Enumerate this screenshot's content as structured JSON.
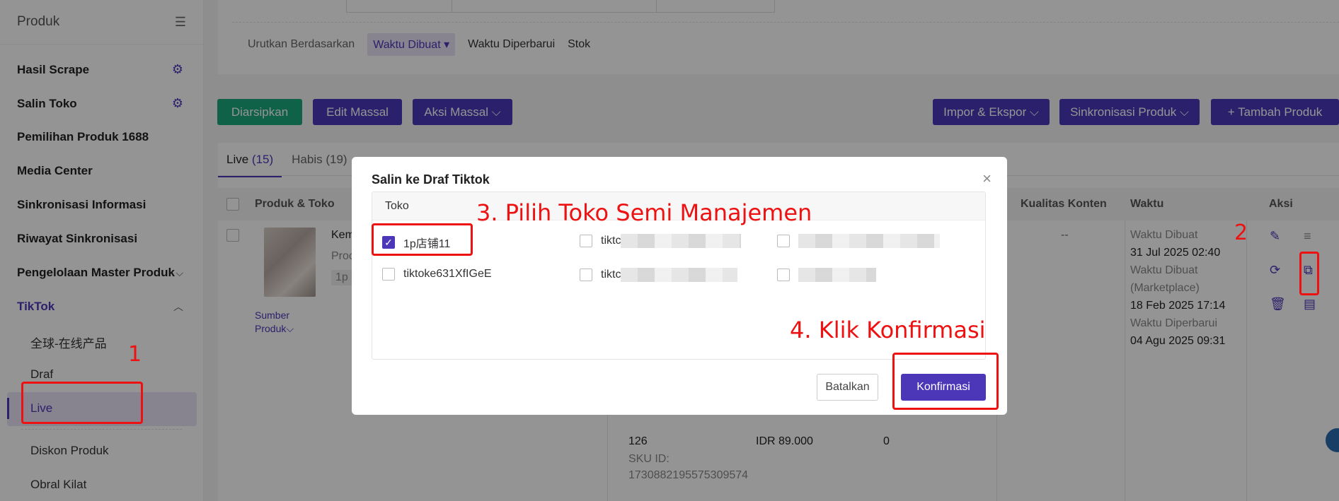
{
  "sidebar": {
    "title": "Produk",
    "items": [
      {
        "label": "Hasil Scrape",
        "icon": "gear-icon"
      },
      {
        "label": "Salin Toko",
        "icon": "gear-icon"
      },
      {
        "label": "Pemilihan Produk 1688"
      },
      {
        "label": "Media Center"
      },
      {
        "label": "Sinkronisasi Informasi"
      },
      {
        "label": "Riwayat Sinkronisasi"
      },
      {
        "label": "Pengelolaan Master Produk"
      },
      {
        "label": "TikTok"
      }
    ],
    "sub_items": [
      "全球-在线产品",
      "Draf",
      "Live",
      "Diskon Produk",
      "Obral Kilat"
    ]
  },
  "sort": {
    "label": "Urutkan Berdasarkan",
    "options": [
      "Waktu Dibuat ▾",
      "Waktu Diperbarui",
      "Stok"
    ]
  },
  "toolbar": {
    "archive": "Diarsipkan",
    "bulk_edit": "Edit Massal",
    "bulk_action": "Aksi Massal ⌵",
    "import_export": "Impor & Ekspor ⌵",
    "sync": "Sinkronisasi Produk ⌵",
    "add": "+ Tambah Produk"
  },
  "tabs": {
    "live": "Live",
    "live_count": "(15)",
    "habis": "Habis (19)"
  },
  "table": {
    "headers": {
      "product": "Produk & Toko",
      "quality": "Kualitas Konten",
      "time": "Waktu",
      "action": "Aksi"
    },
    "row": {
      "name_partial": "Kem",
      "prod_partial": "Proc",
      "tag_partial": "1p",
      "source_label": "Sumber",
      "source_label2": "Produk⌵",
      "quality": "--",
      "created_label": "Waktu Dibuat",
      "created_value": "31 Jul 2025 02:40",
      "mp_created_label": "Waktu Dibuat",
      "mp_created_label2": "(Marketplace)",
      "mp_created_value": "18 Feb 2025 17:14",
      "updated_label": "Waktu Diperbarui",
      "updated_value": "04 Agu 2025 09:31",
      "stock": "126",
      "price": "IDR 89.000",
      "sold": "0",
      "sku_label": "SKU ID:",
      "sku_value": "1730882195575309574"
    }
  },
  "modal": {
    "title": "Salin ke Draf Tiktok",
    "column_header": "Toko",
    "stores": [
      {
        "label": "1p店铺11",
        "checked": true
      },
      {
        "label": "tiktc",
        "checked": false
      },
      {
        "label": "",
        "checked": false
      },
      {
        "label": "tiktoke631XfIGeE",
        "checked": false
      },
      {
        "label": "tiktc",
        "checked": false
      },
      {
        "label": "",
        "checked": false
      }
    ],
    "cancel": "Batalkan",
    "confirm": "Konfirmasi"
  },
  "annotations": {
    "step1": "1",
    "step2": "2",
    "step3": "3. Pilih Toko Semi Manajemen",
    "step4": "4. Klik Konfirmasi"
  },
  "colors": {
    "accent": "#4b37b8",
    "green": "#1aa87c",
    "annotation": "#ee1111"
  }
}
